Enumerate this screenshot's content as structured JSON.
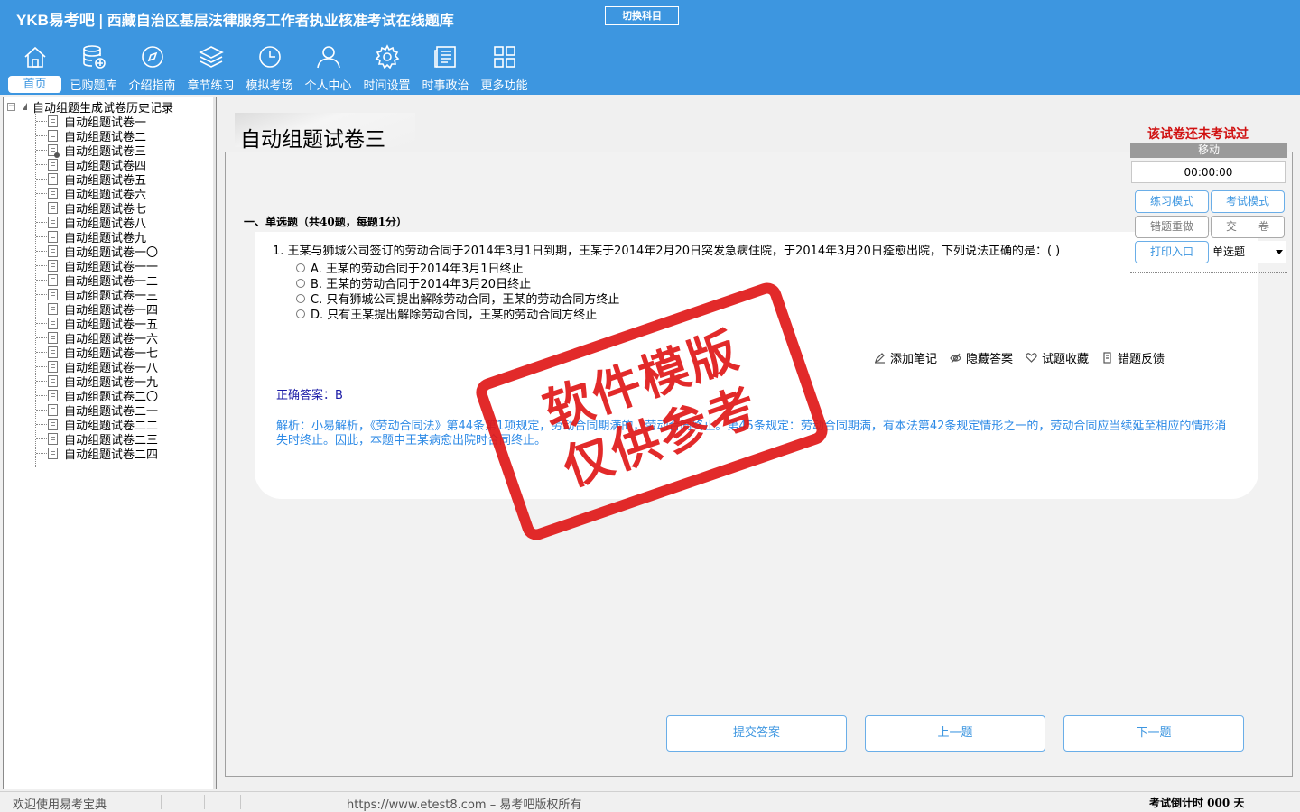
{
  "header": {
    "brand": "YKB易考吧",
    "separator": "|",
    "title": "西藏自治区基层法律服务工作者执业核准考试在线题库",
    "switch_subject": "切换科目"
  },
  "nav": [
    {
      "label": "首页",
      "icon": "home-icon"
    },
    {
      "label": "已购题库",
      "icon": "database-icon"
    },
    {
      "label": "介绍指南",
      "icon": "compass-icon"
    },
    {
      "label": "章节练习",
      "icon": "layers-icon"
    },
    {
      "label": "模拟考场",
      "icon": "clock-icon"
    },
    {
      "label": "个人中心",
      "icon": "user-icon"
    },
    {
      "label": "时间设置",
      "icon": "gear-icon"
    },
    {
      "label": "时事政治",
      "icon": "newspaper-icon"
    },
    {
      "label": "更多功能",
      "icon": "grid-icon"
    }
  ],
  "tree": {
    "expander": "−",
    "root": "自动组题生成试卷历史记录",
    "items": [
      "自动组题试卷一",
      "自动组题试卷二",
      "自动组题试卷三",
      "自动组题试卷四",
      "自动组题试卷五",
      "自动组题试卷六",
      "自动组题试卷七",
      "自动组题试卷八",
      "自动组题试卷九",
      "自动组题试卷一〇",
      "自动组题试卷一一",
      "自动组题试卷一二",
      "自动组题试卷一三",
      "自动组题试卷一四",
      "自动组题试卷一五",
      "自动组题试卷一六",
      "自动组题试卷一七",
      "自动组题试卷一八",
      "自动组题试卷一九",
      "自动组题试卷二〇",
      "自动组题试卷二一",
      "自动组题试卷二二",
      "自动组题试卷二三",
      "自动组题试卷二四"
    ]
  },
  "paper": {
    "title": "自动组题试卷三",
    "section": "一、单选题（共40题，每题1分）"
  },
  "question": {
    "text": "1. 王某与狮城公司签订的劳动合同于2014年3月1日到期，王某于2014年2月20日突发急病住院，于2014年3月20日痊愈出院，下列说法正确的是：( )",
    "options": [
      "A. 王某的劳动合同于2014年3月1日终止",
      "B. 王某的劳动合同于2014年3月20日终止",
      "C. 只有狮城公司提出解除劳动合同，王某的劳动合同方终止",
      "D. 只有王某提出解除劳动合同，王某的劳动合同方终止"
    ],
    "correct_answer": "正确答案：B",
    "analysis": "解析：小易解析，《劳动合同法》第44条第1项规定，劳动合同期满的，劳动合同终止。第45条规定：劳动合同期满，有本法第42条规定情形之一的，劳动合同应当续延至相应的情形消失时终止。因此，本题中王某病愈出院时合同终止。"
  },
  "tools": [
    {
      "label": "添加笔记",
      "icon": "pencil-icon"
    },
    {
      "label": "隐藏答案",
      "icon": "eye-icon"
    },
    {
      "label": "试题收藏",
      "icon": "heart-icon"
    },
    {
      "label": "错题反馈",
      "icon": "feedback-icon"
    }
  ],
  "stamp": {
    "line1": "软件模版",
    "line2": "仅供参考"
  },
  "right_panel": {
    "status": "该试卷还未考试过",
    "move": "移动",
    "timer": "00:00:00",
    "practice_mode": "练习模式",
    "exam_mode": "考试模式",
    "redo_wrong": "错题重做",
    "submit_paper": "交　　卷",
    "print": "打印入口",
    "question_type": "单选题"
  },
  "bottom": {
    "submit": "提交答案",
    "prev": "上一题",
    "next": "下一题"
  },
  "status": {
    "welcome": "欢迎使用易考宝典",
    "url": "https://www.etest8.com – 易考吧版权所有",
    "countdown": "考试倒计时 000 天"
  },
  "colors": {
    "header": "#3d96e0",
    "accent": "#3d96e0",
    "alert": "#d01010",
    "stamp": "#e01818"
  }
}
